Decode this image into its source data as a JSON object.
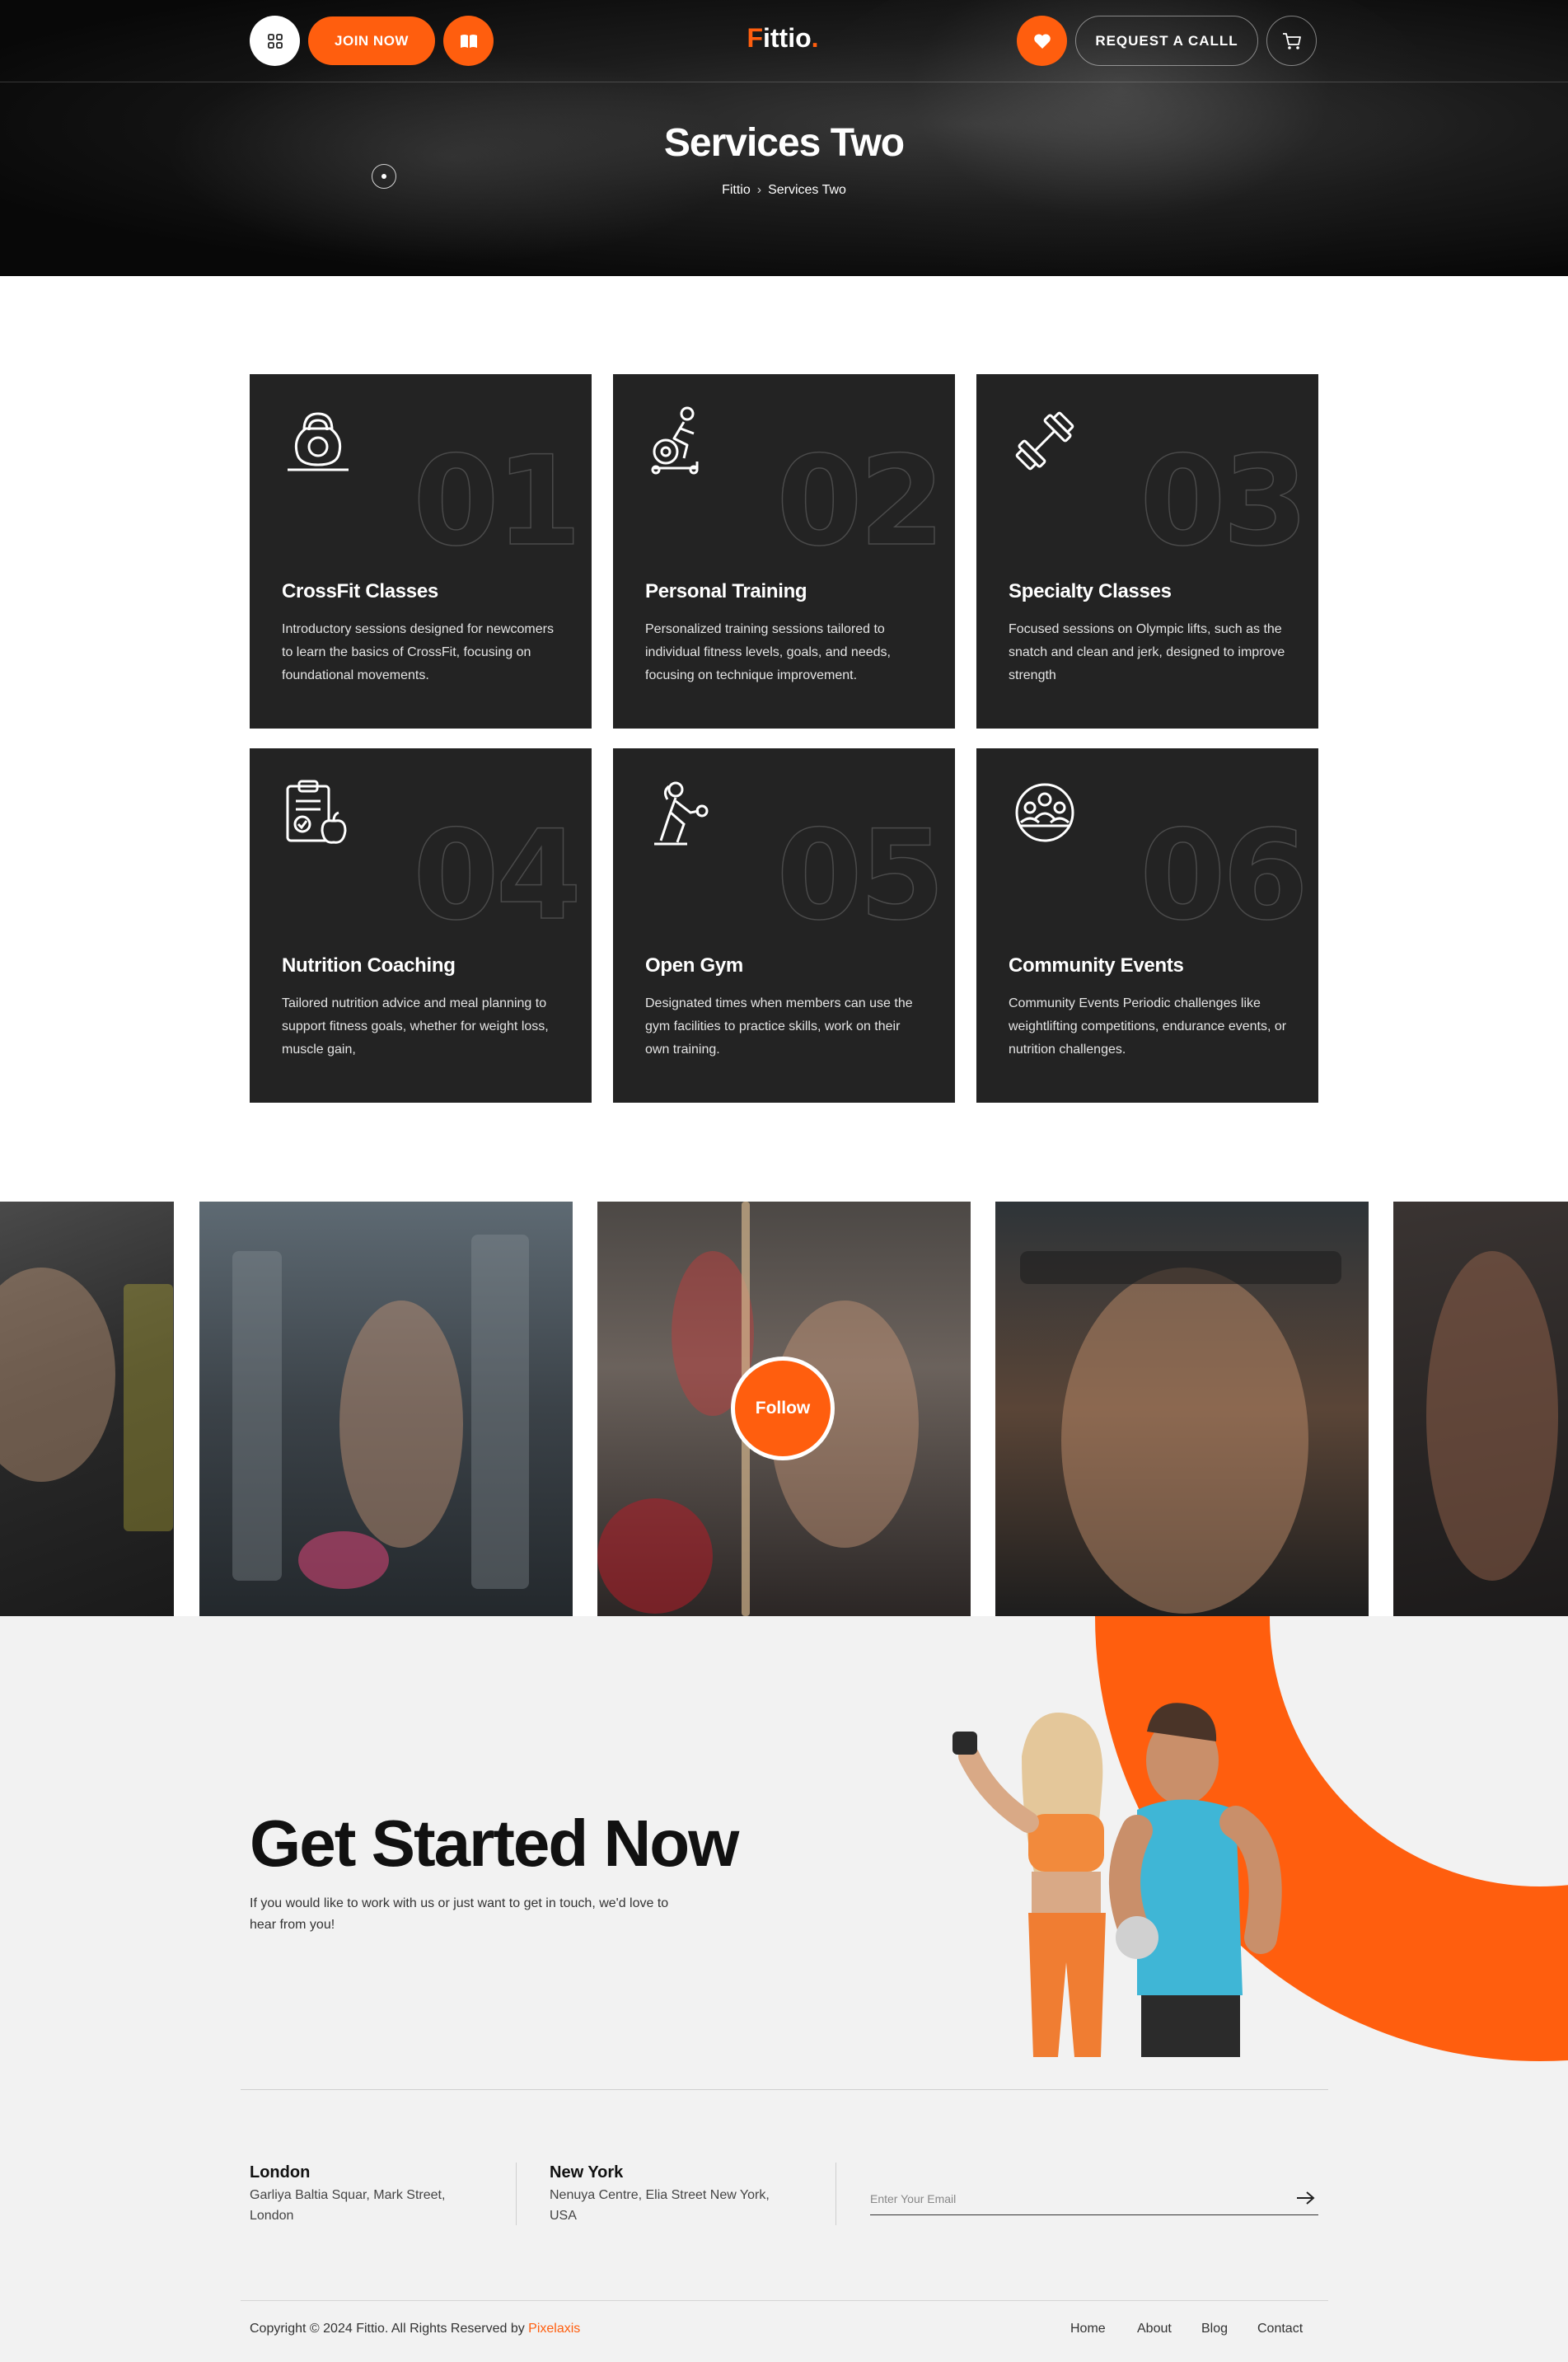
{
  "header": {
    "join_label": "JOIN NOW",
    "logo_main": "ittio",
    "logo_first": "F",
    "logo_dot": ".",
    "call_label": "REQUEST A CALLL",
    "icons": [
      "grid-icon",
      "book-icon",
      "heart-icon",
      "cart-icon"
    ]
  },
  "hero": {
    "title": "Services Two",
    "breadcrumb": [
      "Fittio",
      "Services Two"
    ]
  },
  "services": [
    {
      "number": "01",
      "title": "CrossFit Classes",
      "desc": "Introductory sessions designed for newcomers to learn the basics of CrossFit, focusing on foundational movements.",
      "icon": "kettlebell-icon"
    },
    {
      "number": "02",
      "title": "Personal Training",
      "desc": "Personalized training sessions tailored to individual fitness levels, goals, and needs, focusing on technique improvement.",
      "icon": "exercise-bike-icon"
    },
    {
      "number": "03",
      "title": "Specialty Classes",
      "desc": "Focused sessions on Olympic lifts, such as the snatch and clean and jerk, designed to improve strength",
      "icon": "dumbbell-icon"
    },
    {
      "number": "04",
      "title": "Nutrition Coaching",
      "desc": "Tailored nutrition advice and meal planning to support fitness goals, whether for weight loss, muscle gain,",
      "icon": "nutrition-clipboard-icon"
    },
    {
      "number": "05",
      "title": "Open Gym",
      "desc": "Designated times when members can use the gym facilities to practice skills, work on their own training.",
      "icon": "woman-lifting-icon"
    },
    {
      "number": "06",
      "title": "Community Events",
      "desc": "Community Events Periodic challenges like weightlifting competitions, endurance events, or nutrition challenges.",
      "icon": "community-icon"
    }
  ],
  "gallery": {
    "follow_label": "Follow"
  },
  "cta": {
    "heading": "Get Started Now",
    "text": "If you would like to work with us or just want to get in touch, we'd love to hear from you!",
    "offices": [
      {
        "city": "London",
        "address": "Garliya Baltia Squar, Mark Street, London"
      },
      {
        "city": "New York",
        "address": "Nenuya Centre, Elia Street New York, USA"
      }
    ],
    "email_placeholder": "Enter Your Email"
  },
  "footer": {
    "copyright": "Copyright © 2024 Fittio. All Rights Reserved by",
    "brand": "Pixelaxis",
    "nav": [
      "Home",
      "About",
      "Blog",
      "Contact"
    ]
  },
  "colors": {
    "accent": "#ff5e0e",
    "card_bg": "#232323",
    "hero_bg": "#0b0b0b",
    "cta_bg": "#f2f2f2"
  }
}
